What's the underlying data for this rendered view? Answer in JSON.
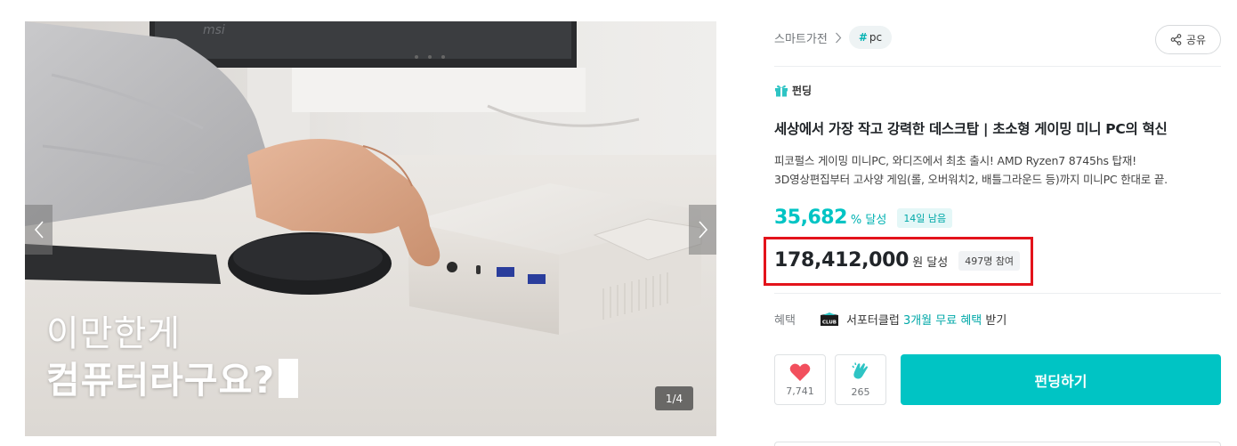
{
  "gallery": {
    "overlay_line1": "이만한게",
    "overlay_line2": "컴퓨터라구요?",
    "counter": "1/4",
    "monitor_brand": "msi"
  },
  "breadcrumb": {
    "category": "스마트가전",
    "tag": "pc"
  },
  "share": {
    "label": "공유"
  },
  "project": {
    "type": "펀딩",
    "title": "세상에서 가장 작고 강력한 데스크탑 | 초소형 게이밍 미니 PC의 혁신",
    "desc_line1": "피코펄스 게이밍 미니PC, 와디즈에서 최초 출시! AMD Ryzen7 8745hs 탑재!",
    "desc_line2": "3D영상편집부터 고사양 게임(롤, 오버워치2, 배틀그라운드 등)까지 미니PC 한대로 끝."
  },
  "stats": {
    "rate": "35,682",
    "rate_unit": "% 달성",
    "days_left": "14일 남음",
    "amount": "178,412,000",
    "amount_unit": "원 달성",
    "participants": "497명 참여"
  },
  "benefit": {
    "label": "혜택",
    "text_prefix": "서포터클럽 ",
    "text_link": "3개월 무료 혜택",
    "text_suffix": " 받기",
    "logo_text": "CLUB"
  },
  "actions": {
    "like_count": "7,741",
    "cheer_count": "265",
    "fund_label": "펀딩하기"
  },
  "colors": {
    "accent": "#00c4c4",
    "highlight": "#e3131b",
    "like": "#f24f5d"
  }
}
